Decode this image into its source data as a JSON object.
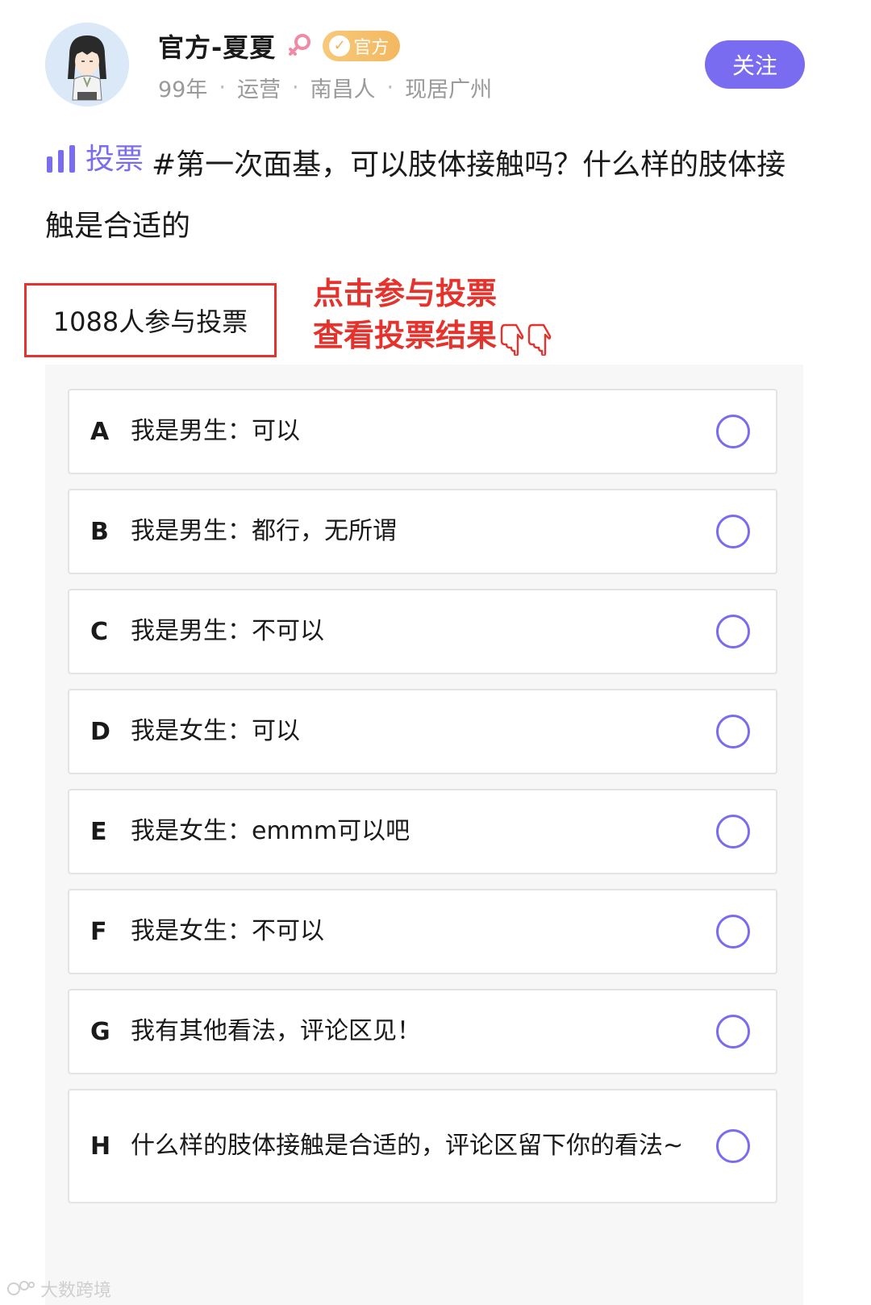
{
  "profile": {
    "name": "官方-夏夏",
    "gender_icon": "female-icon",
    "badge_label": "官方",
    "meta": [
      "99年",
      "运营",
      "南昌人",
      "现居广州"
    ],
    "follow_label": "关注"
  },
  "post": {
    "tag_label": "投票",
    "title": "#第一次面基，可以肢体接触吗？什么样的肢体接触是合适的"
  },
  "poll": {
    "participants": "1088人参与投票",
    "options": [
      {
        "letter": "A",
        "text": "我是男生：可以"
      },
      {
        "letter": "B",
        "text": "我是男生：都行，无所谓"
      },
      {
        "letter": "C",
        "text": "我是男生：不可以"
      },
      {
        "letter": "D",
        "text": "我是女生：可以"
      },
      {
        "letter": "E",
        "text": "我是女生：emmm可以吧"
      },
      {
        "letter": "F",
        "text": "我是女生：不可以"
      },
      {
        "letter": "G",
        "text": "我有其他看法，评论区见！"
      },
      {
        "letter": "H",
        "text": "什么样的肢体接触是合适的，评论区留下你的看法~"
      }
    ]
  },
  "annotation": {
    "line1": "点击参与投票",
    "line2": "查看投票结果"
  },
  "watermark": {
    "text": "大数跨境"
  },
  "colors": {
    "accent": "#7a6cf0",
    "annotation_red": "#e5322d",
    "badge_gold": "#f3b860",
    "meta_gray": "#9a9a9a"
  }
}
